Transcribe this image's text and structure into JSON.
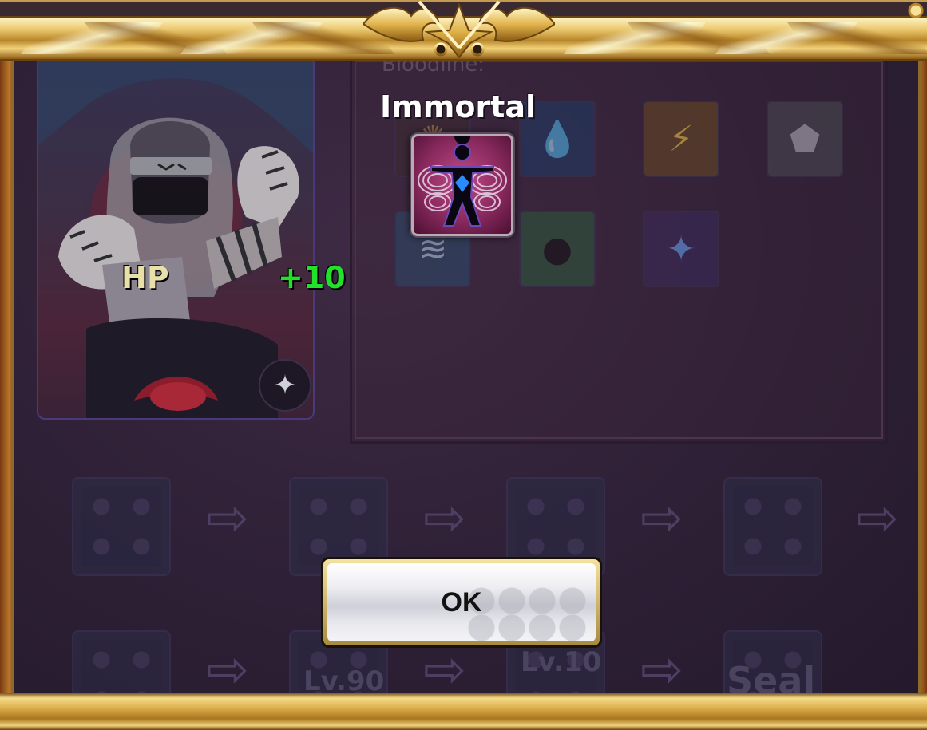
{
  "popup": {
    "skill_name": "Immortal",
    "stat_label": "HP",
    "stat_value": "+10",
    "ok_label": "OK"
  },
  "background": {
    "bloodline_heading": "Bloodline:",
    "row2_labels": [
      "Lv.90",
      "Lv.10",
      "Seal"
    ]
  },
  "colors": {
    "stat_label": "#e8e0a8",
    "stat_value": "#22e12a",
    "gold_frame": "#d8a846",
    "panel_bg": "#2e2036"
  },
  "icons": {
    "slots_row1": [
      "fire-swirl-icon",
      "water-drop-icon",
      "lightning-icon",
      "earth-rock-icon"
    ],
    "slots_row2": [
      "wind-icon",
      "body-aura-icon",
      "immortal-body-icon"
    ],
    "highlight": "immortal-body-icon",
    "badge": "shuriken-icon"
  }
}
